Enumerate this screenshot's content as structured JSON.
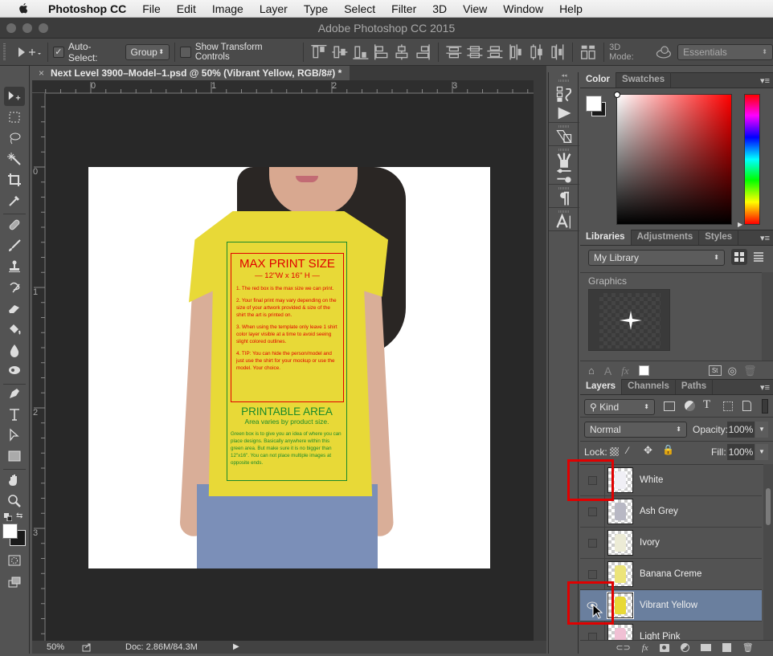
{
  "menubar": {
    "app_name": "Photoshop CC",
    "items": [
      "File",
      "Edit",
      "Image",
      "Layer",
      "Type",
      "Select",
      "Filter",
      "3D",
      "View",
      "Window",
      "Help"
    ]
  },
  "window": {
    "title": "Adobe Photoshop CC 2015"
  },
  "options_bar": {
    "auto_select_label": "Auto-Select:",
    "auto_select_checked": true,
    "auto_select_value": "Group",
    "show_transform_label": "Show Transform Controls",
    "show_transform_checked": false,
    "mode_3d_label": "3D Mode:",
    "workspace_value": "Essentials"
  },
  "document": {
    "tab_title": "Next Level 3900–Model–1.psd @ 50% (Vibrant Yellow, RGB/8#) *",
    "ruler_top_labels": [
      "0",
      "1",
      "2",
      "3"
    ],
    "ruler_left_labels": [
      "0",
      "1",
      "2",
      "3"
    ],
    "zoom": "50%",
    "doc_info": "Doc: 2.86M/84.3M"
  },
  "artwork": {
    "max_title": "MAX PRINT SIZE",
    "max_sub": "— 12\"W x 16\" H —",
    "notes": [
      "1. The red box is the max size we can print.",
      "2. Your final print may vary depending on the size of your artwork provided & size of the shirt the art is printed on.",
      "3. When using the template only leave 1 shirt color layer visible at a time to avoid seeing slight colored outlines.",
      "4. TIP: You can hide the person/model and just use the shirt for your mockup or use the model. Your choice."
    ],
    "print_title": "PRINTABLE AREA",
    "print_sub": "Area varies by product size.",
    "print_note": "Green box is to give you an idea of where you can place designs. Basically anywhere within this green area.  But make sure it is no bigger than 12\"x16\".  You can not place multiple images at opposite ends.",
    "shirt_color": "#e8d937",
    "max_color": "#e00000",
    "print_color": "#1a8a2a"
  },
  "color_panel": {
    "tabs": [
      "Color",
      "Swatches"
    ],
    "active_tab": "Color",
    "foreground": "#ffffff",
    "background": "#1a1a1a",
    "hue": "#ff0000"
  },
  "libraries_panel": {
    "tabs": [
      "Libraries",
      "Adjustments",
      "Styles"
    ],
    "active_tab": "Libraries",
    "library": "My Library",
    "section": "Graphics"
  },
  "layers_panel": {
    "tabs": [
      "Layers",
      "Channels",
      "Paths"
    ],
    "active_tab": "Layers",
    "filter": "Kind",
    "blend_mode": "Normal",
    "opacity_label": "Opacity:",
    "opacity": "100%",
    "lock_label": "Lock:",
    "fill_label": "Fill:",
    "fill": "100%",
    "layers": [
      {
        "name": "White",
        "visible": false,
        "selected": false,
        "color": "#f0eff5"
      },
      {
        "name": "Ash Grey",
        "visible": false,
        "selected": false,
        "color": "#b8b8c4"
      },
      {
        "name": "Ivory",
        "visible": false,
        "selected": false,
        "color": "#ecebd6"
      },
      {
        "name": "Banana Creme",
        "visible": false,
        "selected": false,
        "color": "#ece47a"
      },
      {
        "name": "Vibrant Yellow",
        "visible": true,
        "selected": true,
        "color": "#e8d937"
      },
      {
        "name": "Light Pink",
        "visible": false,
        "selected": false,
        "color": "#f0c0d4"
      }
    ]
  }
}
